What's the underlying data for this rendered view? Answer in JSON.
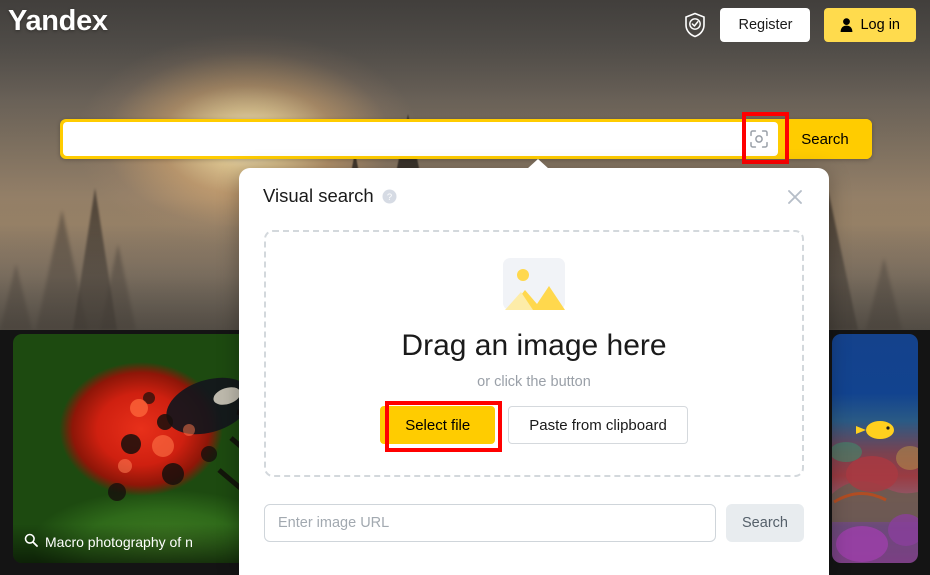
{
  "header": {
    "logo": "Yandex",
    "shield_icon": "shield-check-icon",
    "register_label": "Register",
    "login_label": "Log in",
    "login_icon": "person-icon"
  },
  "search": {
    "value": "",
    "placeholder": "",
    "camera_icon": "visual-search-viewfinder-icon",
    "search_label": "Search"
  },
  "modal": {
    "title": "Visual search",
    "help_icon": "help-circle-icon",
    "close_icon": "close-x-icon",
    "dropzone": {
      "image_icon": "image-placeholder-icon",
      "title": "Drag an image here",
      "subtitle": "or click the button",
      "select_file_label": "Select file",
      "paste_label": "Paste from clipboard"
    },
    "url": {
      "value": "",
      "placeholder": "Enter image URL",
      "search_label": "Search"
    }
  },
  "cards": [
    {
      "name": "ladybug",
      "caption": "Macro photography of n",
      "icon": "magnifier-icon"
    },
    {
      "name": "middle",
      "caption": "",
      "icon": ""
    },
    {
      "name": "coral-reef",
      "caption": "",
      "icon": ""
    }
  ],
  "annotations": [
    {
      "name": "camera-button-highlight",
      "color": "#ff0000"
    },
    {
      "name": "select-file-highlight",
      "color": "#ff0000"
    }
  ],
  "colors": {
    "brand_yellow": "#ffcc00",
    "login_yellow": "#ffdb4d",
    "highlight_red": "#ff0000",
    "muted_text": "#9aa0a8"
  }
}
